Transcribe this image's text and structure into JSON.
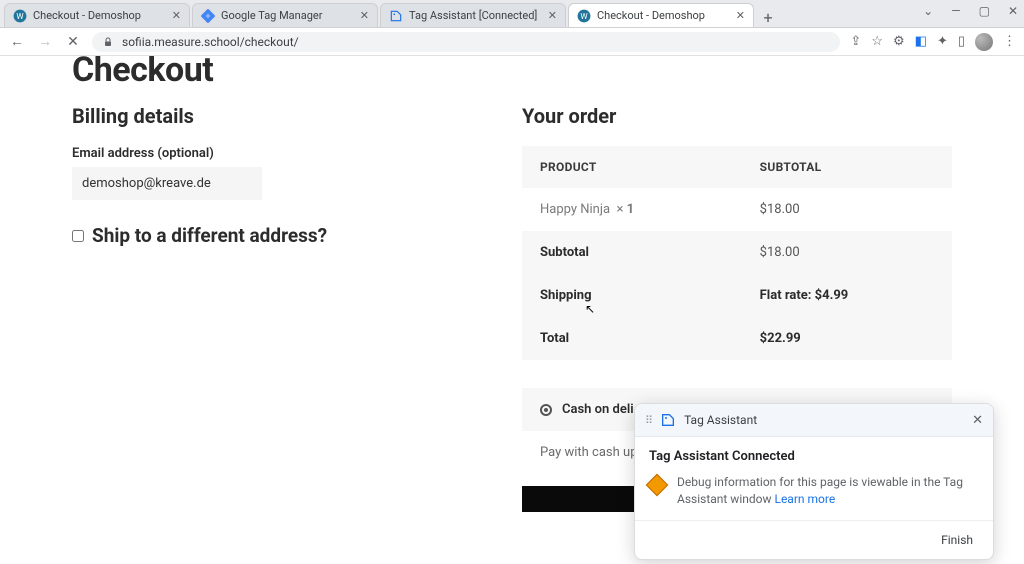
{
  "browser": {
    "tabs": [
      {
        "title": "Checkout - Demoshop",
        "favicon": "wordpress",
        "active": false
      },
      {
        "title": "Google Tag Manager",
        "favicon": "gtm",
        "active": false
      },
      {
        "title": "Tag Assistant [Connected]",
        "favicon": "tagassist",
        "active": false
      },
      {
        "title": "Checkout - Demoshop",
        "favicon": "wordpress",
        "active": true
      }
    ],
    "url": "sofiia.measure.school/checkout/"
  },
  "page": {
    "heading": "Checkout",
    "billing_title": "Billing details",
    "email_label": "Email address (optional)",
    "email_value": "demoshop@kreave.de",
    "ship_label": "Ship to a different address?",
    "order_title": "Your order",
    "col_product": "PRODUCT",
    "col_subtotal": "SUBTOTAL",
    "item": {
      "name": "Happy Ninja",
      "qty_prefix": "× ",
      "qty": "1",
      "price": "$18.00"
    },
    "subtotal_label": "Subtotal",
    "subtotal_value": "$18.00",
    "shipping_label": "Shipping",
    "shipping_value": "Flat rate: $4.99",
    "total_label": "Total",
    "total_value": "$22.99",
    "pay_option": "Cash on deli",
    "pay_note": "Pay with cash up"
  },
  "popup": {
    "header": "Tag Assistant",
    "title": "Tag Assistant Connected",
    "body": "Debug information for this page is viewable in the Tag Assistant window ",
    "link": "Learn more",
    "finish": "Finish"
  }
}
